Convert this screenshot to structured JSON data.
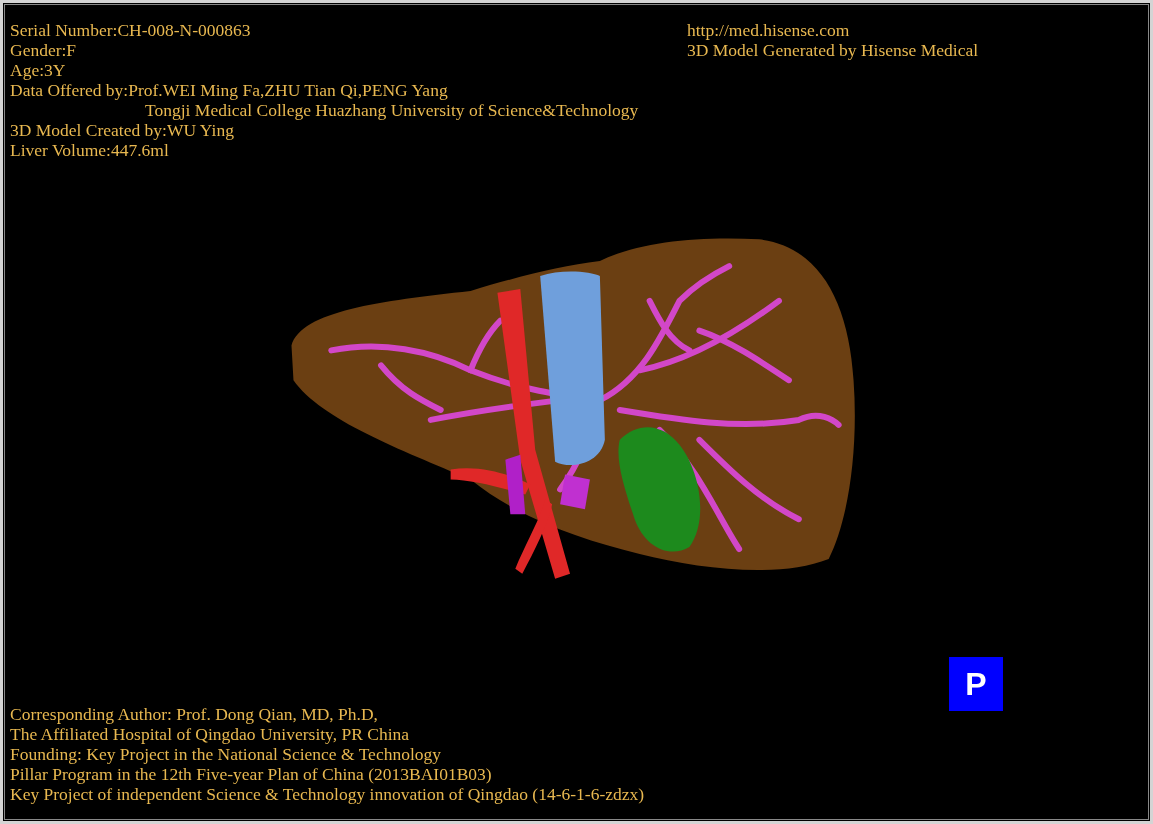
{
  "patient_info": [
    {
      "text": "Serial Number:CH-008-N-000863"
    },
    {
      "text": "Gender:F"
    },
    {
      "text": "Age:3Y"
    },
    {
      "text": "Data Offered by:Prof.WEI Ming Fa,ZHU Tian Qi,PENG Yang",
      "continuation": "Tongji Medical College Huazhang University of Science&Technology"
    },
    {
      "text": "3D Model Created by:WU Ying"
    },
    {
      "text": "Liver Volume:447.6ml"
    }
  ],
  "site_info": [
    "http://med.hisense.com",
    "3D Model Generated by Hisense Medical"
  ],
  "credits": [
    "Corresponding Author: Prof. Dong Qian, MD, Ph.D,",
    "The Affiliated Hospital of Qingdao University, PR China",
    "Founding: Key Project in the National Science & Technology",
    "Pillar Program in the 12th Five-year Plan of China (2013BAI01B03)",
    "Key Project of independent Science & Technology innovation of Qingdao (14-6-1-6-zdzx)"
  ],
  "view_button": {
    "label": "P"
  }
}
